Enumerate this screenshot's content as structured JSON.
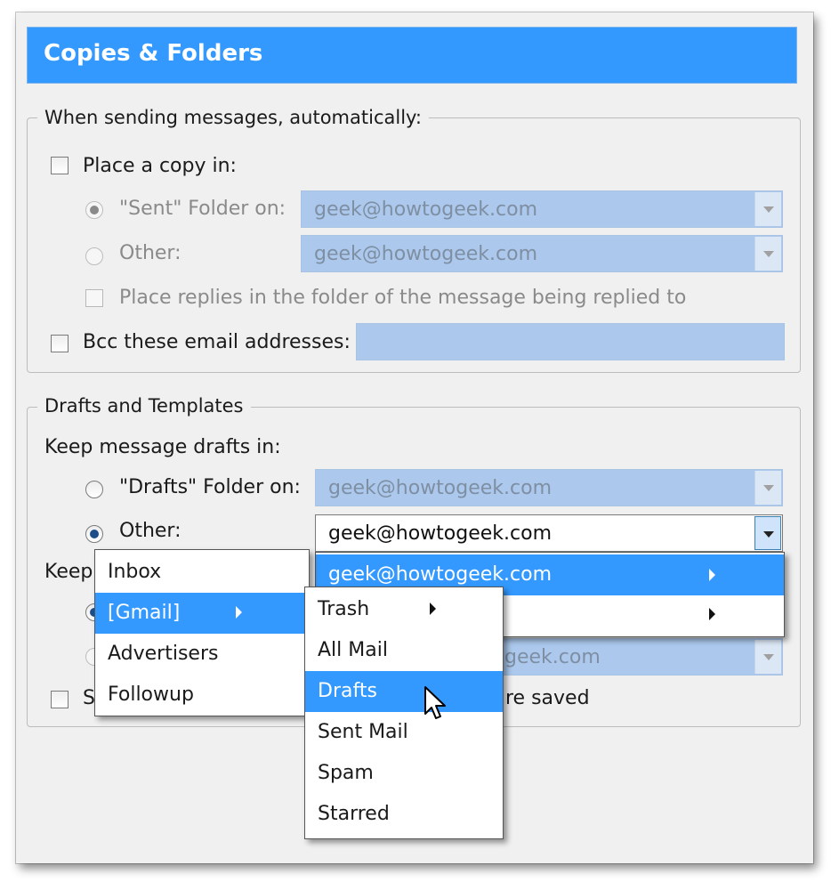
{
  "title": "Copies & Folders",
  "sending": {
    "legend": "When sending messages, automatically:",
    "place_copy_label": "Place a copy in:",
    "sent_folder_label": "\"Sent\" Folder on:",
    "sent_folder_value": "geek@howtogeek.com",
    "other_label": "Other:",
    "other_value": "geek@howtogeek.com",
    "place_replies_label": "Place replies in the folder of the message being replied to",
    "bcc_label": "Bcc these email addresses:",
    "bcc_value": ""
  },
  "drafts": {
    "legend": "Drafts and Templates",
    "keep_drafts_label": "Keep message drafts in:",
    "drafts_folder_label": "\"Drafts\" Folder on:",
    "drafts_folder_value": "geek@howtogeek.com",
    "other_label": "Other:",
    "other_value": "geek@howtogeek.com",
    "keep_templates_label_partial": "Keep",
    "templates_folder_value_partial": "geek.com",
    "show_confirm_partial_start": "S",
    "show_confirm_partial_end": "re saved"
  },
  "account_menu": {
    "items": [
      "geek@howtogeek.com",
      ""
    ]
  },
  "folder_menu": {
    "items": [
      "Inbox",
      "[Gmail]",
      "Advertisers",
      "Followup"
    ]
  },
  "gmail_menu": {
    "items": [
      "Trash",
      "All Mail",
      "Drafts",
      "Sent Mail",
      "Spam",
      "Starred"
    ]
  },
  "icons": {
    "submenu": "triangle-right-icon",
    "dropdown": "chevron-down-icon",
    "cursor": "arrow-cursor-icon"
  },
  "colors": {
    "accent": "#3399ff",
    "disabled_field": "#acc9ed"
  }
}
